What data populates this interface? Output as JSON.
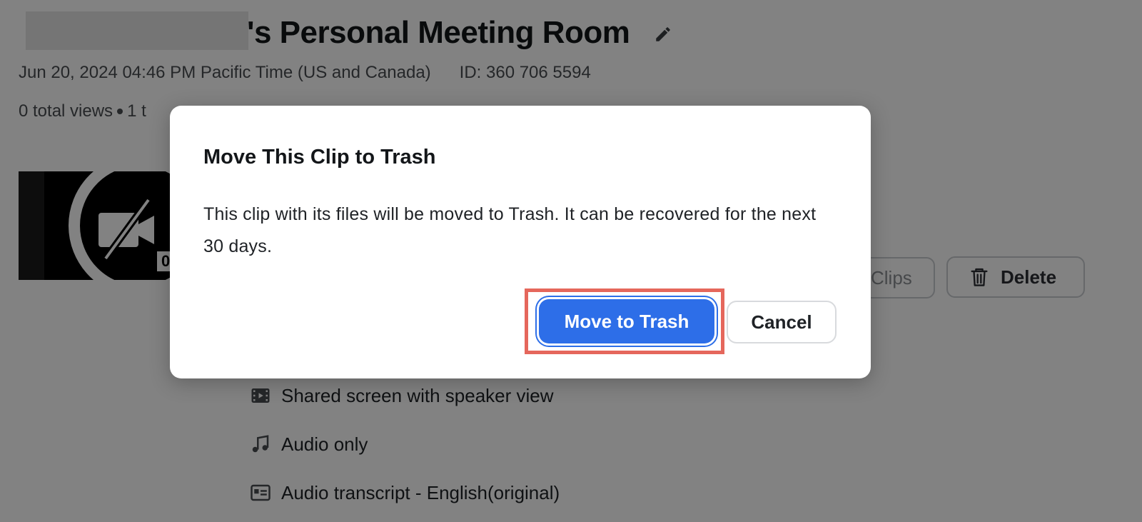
{
  "recording": {
    "title": "'s Personal Meeting Room",
    "datetime": "Jun 20, 2024 04:46 PM Pacific Time (US and Canada)",
    "meeting_id": "ID: 360 706 5594",
    "views": "0 total views",
    "views_extra": "1 t",
    "thumbnail_duration": "0"
  },
  "actions": {
    "clips_label": "Clips",
    "delete_label": "Delete"
  },
  "files": [
    {
      "label": "Shared screen with speaker view",
      "icon": "video-file-icon"
    },
    {
      "label": "Audio only",
      "icon": "music-note-icon"
    },
    {
      "label": "Audio transcript - English(original)",
      "icon": "transcript-icon"
    }
  ],
  "dialog": {
    "title": "Move This Clip to Trash",
    "body": "This clip with its files will be moved to Trash. It can be recovered for the next 30 days.",
    "confirm_label": "Move to Trash",
    "cancel_label": "Cancel"
  },
  "colors": {
    "primary": "#2d6ee8",
    "highlight": "#e5675c",
    "overlay": "rgba(0,0,0,0.49)"
  }
}
